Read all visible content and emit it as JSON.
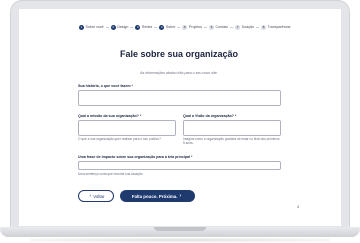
{
  "stepper": {
    "steps": [
      {
        "number": "1",
        "label": "Sobre você"
      },
      {
        "number": "2",
        "label": "Design"
      },
      {
        "number": "3",
        "label": "Redes"
      },
      {
        "number": "4",
        "label": "Sobre"
      },
      {
        "number": "5",
        "label": "Projetos"
      },
      {
        "number": "6",
        "label": "Contato"
      },
      {
        "number": "7",
        "label": "Doação"
      },
      {
        "number": "8",
        "label": "Transparência"
      }
    ],
    "current_step": 4
  },
  "form": {
    "title": "Fale sobre sua organização",
    "subtitle": "As informações abaixo irão para o seu novo site.",
    "history": {
      "label": "Sua história, o que você fazem *",
      "value": ""
    },
    "mission": {
      "label": "Qual a missão da sua organização? *",
      "value": "",
      "hint": "O que a sua organização quer realizar para o seu público?"
    },
    "vision": {
      "label": "Qual a Visão da organização? *",
      "value": "",
      "hint": "Imagine como a organização gostaria de estar no final dos próximos 5 anos."
    },
    "impact": {
      "label": "Uma frase de impacto sobre sua organização para a tela principal *",
      "value": "",
      "hint": "Uma sentença curta que resume sua atuação."
    }
  },
  "buttons": {
    "back_label": "Voltar",
    "next_label": "Falta pouco. Próxima."
  },
  "page_number": "4",
  "colors": {
    "primary": "#1f3a6e",
    "text": "#1b2440",
    "muted": "#6b7080",
    "border": "#aeb3bf",
    "frame": "#e4e5e8"
  }
}
